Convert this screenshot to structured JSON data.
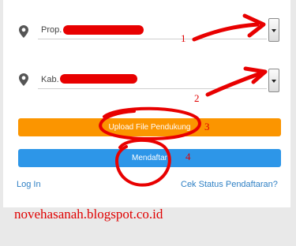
{
  "form": {
    "province_field": {
      "label": "Prop."
    },
    "regency_field": {
      "label": "Kab."
    },
    "upload_button": {
      "label": "Upload File Pendukung"
    },
    "register_button": {
      "label": "Mendaftar"
    },
    "login_link": {
      "label": "Log In"
    },
    "status_link": {
      "label": "Cek Status Pendaftaran?"
    }
  },
  "annotations": {
    "numbers": [
      "1",
      "2",
      "3",
      "4"
    ],
    "watermark": "novehasanah.blogspot.co.id"
  },
  "colors": {
    "upload_button": "#fb9500",
    "register_button": "#2d96e8",
    "link": "#2f80c4",
    "annotation": "#e80000"
  }
}
